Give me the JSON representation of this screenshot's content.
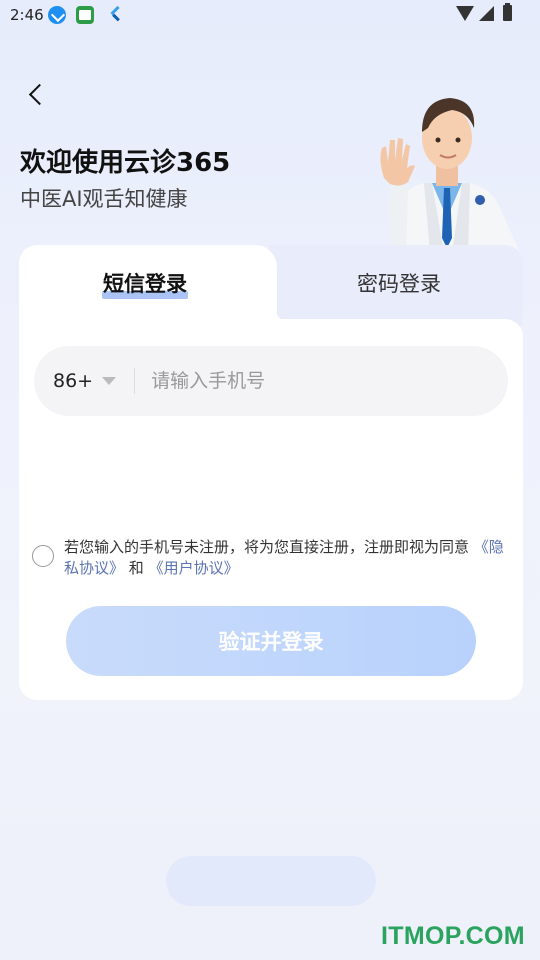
{
  "status_bar": {
    "time": "2:46",
    "icons": [
      "download-icon",
      "app-icon",
      "flutter-icon",
      "wifi-icon",
      "signal-icon",
      "battery-icon"
    ]
  },
  "header": {
    "back_icon": "chevron-left-icon",
    "title": "欢迎使用云诊365",
    "subtitle": "中医AI观舌知健康"
  },
  "tabs": [
    {
      "label": "短信登录",
      "active": true
    },
    {
      "label": "密码登录",
      "active": false
    }
  ],
  "phone": {
    "country_code": "86+",
    "placeholder": "请输入手机号",
    "value": ""
  },
  "agreement": {
    "text_before": "若您输入的手机号未注册，将为您直接注册，注册即视为同意",
    "privacy_link": "《隐私协议》",
    "and": "和",
    "user_link": "《用户协议》",
    "checked": false
  },
  "submit_label": "验证并登录",
  "watermark": "ITMOP.COM",
  "colors": {
    "accent": "#a9c4f5",
    "link": "#5a73b3",
    "button_gradient_start": "#c9dbfb",
    "button_gradient_end": "#b8d2fc",
    "watermark": "#2aa35f"
  }
}
